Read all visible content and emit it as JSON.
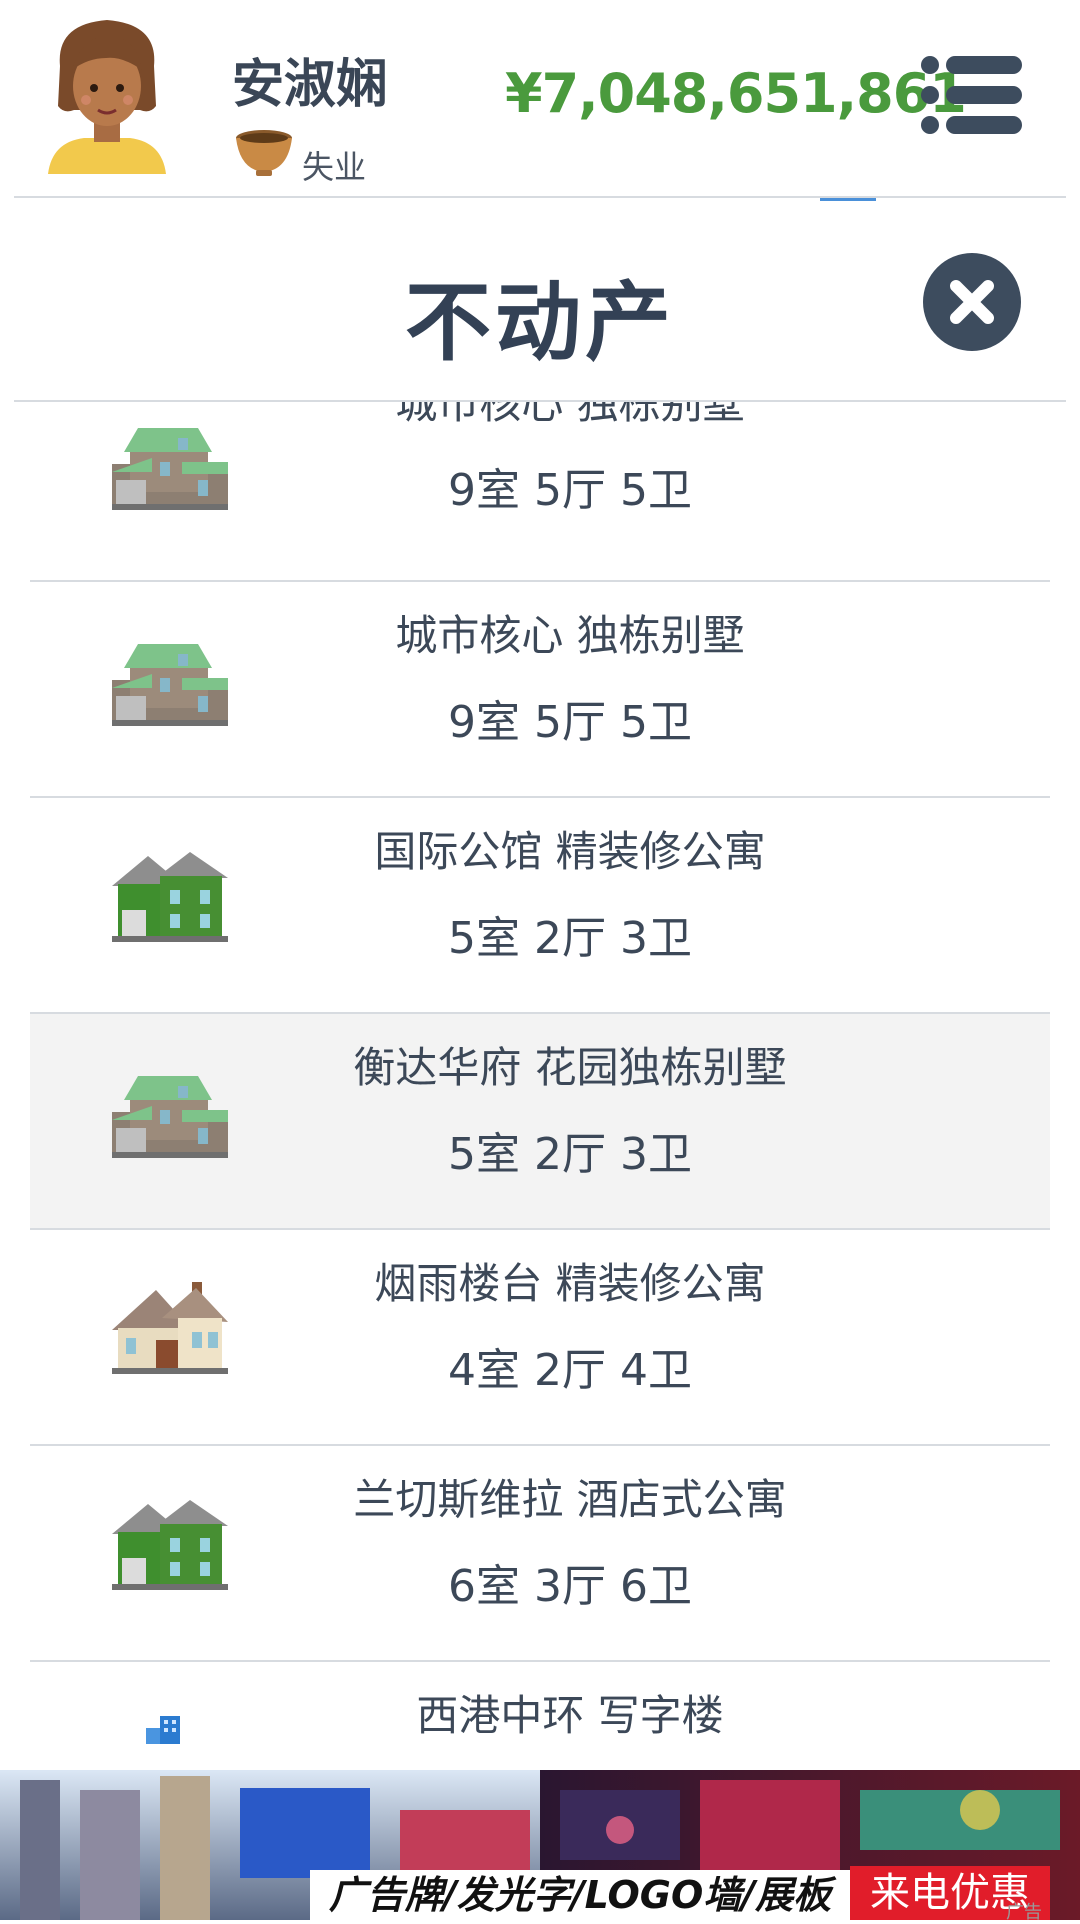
{
  "header": {
    "user_name": "安淑娴",
    "job_label": "失业",
    "money": "¥7,048,651,861",
    "avatar_icon": "woman-avatar",
    "job_icon": "bowl-icon",
    "menu_icon": "list-menu-icon"
  },
  "section": {
    "title": "不动产",
    "close_icon": "close-icon"
  },
  "properties": [
    {
      "name": "城市核心 独栋别墅",
      "rooms": "9室 5厅 5卫",
      "icon": "green-roof-house-icon"
    },
    {
      "name": "城市核心 独栋别墅",
      "rooms": "9室 5厅 5卫",
      "icon": "green-roof-house-icon"
    },
    {
      "name": "国际公馆 精装修公寓",
      "rooms": "5室 2厅 3卫",
      "icon": "green-house-icon"
    },
    {
      "name": "衡达华府 花园独栋别墅",
      "rooms": "5室 2厅 3卫",
      "icon": "green-roof-house-icon"
    },
    {
      "name": "烟雨楼台 精装修公寓",
      "rooms": "4室 2厅 4卫",
      "icon": "beige-house-icon"
    },
    {
      "name": "兰切斯维拉 酒店式公寓",
      "rooms": "6室 3厅 6卫",
      "icon": "green-house-icon"
    },
    {
      "name": "西港中环 写字楼",
      "rooms": "",
      "icon": "office-building-icon"
    }
  ],
  "ad": {
    "text": "广告牌/发光字/LOGO墙/展板",
    "cta": "来电优惠",
    "label": "广告"
  },
  "colors": {
    "money": "#4a9a3d",
    "text": "#3a4656",
    "active_row": "#f3f3f3",
    "ad_cta": "#e11d2a"
  }
}
